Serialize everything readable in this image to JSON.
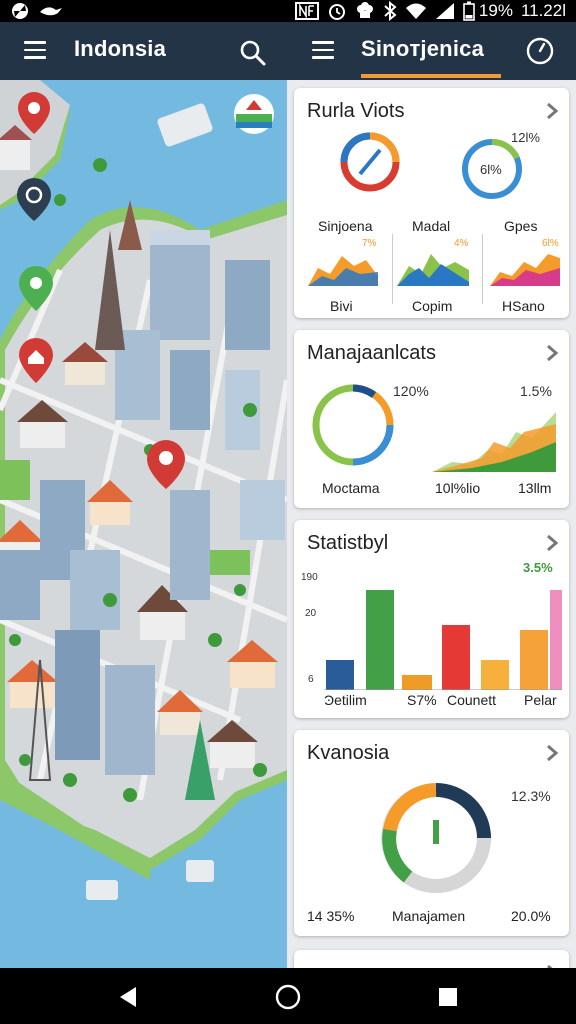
{
  "status_bar": {
    "battery": "19%",
    "time": "11.22l"
  },
  "left_appbar": {
    "title": "Indonsia"
  },
  "right_appbar": {
    "title": "Sinoтjenica"
  },
  "cards": {
    "card1": {
      "title": "Rurla Viots",
      "percent_label": "12l%",
      "ring_value_label": "6l%",
      "row_labels": [
        "Sinjoena",
        "Madal",
        "Gpes"
      ],
      "mini_chart_values": [
        "7%",
        "4%",
        "6l%"
      ],
      "bottom_labels": [
        "Bivi",
        "Copim",
        "HSano"
      ]
    },
    "card2": {
      "title": "Manajaanlcats",
      "donut_label": "120%",
      "right_value": "1.5%",
      "bottom_labels": [
        "Moctama",
        "10l%lio",
        "13llm"
      ]
    },
    "card3": {
      "title": "Statistbyl",
      "highlight_value": "3.5%",
      "y_ticks": [
        "190",
        "20",
        "6"
      ],
      "x_labels": [
        "Ͽetilim",
        "S7%",
        "Counett",
        "Pelar"
      ]
    },
    "card4": {
      "title": "Kvanosia",
      "right_value": "12.3%",
      "bottom_labels": [
        "14 35%",
        "Manajamen",
        "20.0%"
      ]
    }
  },
  "chart_data": [
    {
      "type": "bar",
      "categories": [
        "",
        "",
        "",
        "",
        "",
        "",
        "",
        ""
      ],
      "values": [
        6,
        20,
        3,
        13,
        6,
        12,
        20,
        22
      ],
      "colors": [
        "#2a5c9a",
        "#43a047",
        "#ef9b28",
        "#e53935",
        "#f6b03b",
        "#f6a23b",
        "#ef8fbf"
      ],
      "ylim": [
        0,
        24
      ],
      "grid": false
    }
  ],
  "colors": {
    "appbar": "#233447",
    "accent": "#f29a38",
    "pin_red": "#d23a35",
    "pin_green": "#4caf50",
    "pin_dark": "#2c3e50"
  }
}
